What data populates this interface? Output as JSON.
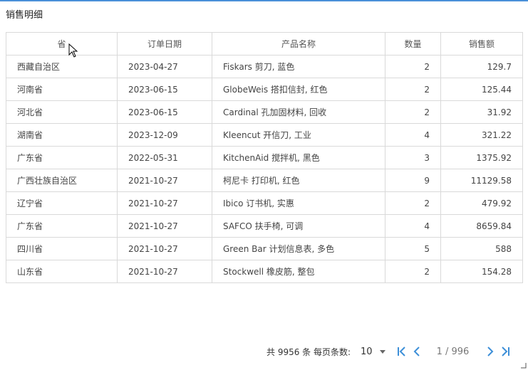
{
  "title": "销售明细",
  "table": {
    "columns": [
      "省",
      "订单日期",
      "产品名称",
      "数量",
      "销售额"
    ],
    "rows": [
      [
        "西藏自治区",
        "2023-04-27",
        "Fiskars 剪刀, 蓝色",
        "2",
        "129.7"
      ],
      [
        "河南省",
        "2023-06-15",
        "GlobeWeis 搭扣信封, 红色",
        "2",
        "125.44"
      ],
      [
        "河北省",
        "2023-06-15",
        "Cardinal 孔加固材料, 回收",
        "2",
        "31.92"
      ],
      [
        "湖南省",
        "2023-12-09",
        "Kleencut 开信刀, 工业",
        "4",
        "321.22"
      ],
      [
        "广东省",
        "2022-05-31",
        "KitchenAid 搅拌机, 黑色",
        "3",
        "1375.92"
      ],
      [
        "广西壮族自治区",
        "2021-10-27",
        "柯尼卡 打印机, 红色",
        "9",
        "11129.58"
      ],
      [
        "辽宁省",
        "2021-10-27",
        "Ibico 订书机, 实惠",
        "2",
        "479.92"
      ],
      [
        "广东省",
        "2021-10-27",
        "SAFCO 扶手椅, 可调",
        "4",
        "8659.84"
      ],
      [
        "四川省",
        "2021-10-27",
        "Green Bar 计划信息表, 多色",
        "5",
        "588"
      ],
      [
        "山东省",
        "2021-10-27",
        "Stockwell 橡皮筋, 整包",
        "2",
        "154.28"
      ]
    ]
  },
  "pager": {
    "total_text": "共 9956 条 每页条数:",
    "page_size": "10",
    "page_info": "1 / 996",
    "accent_color": "#3d8fd8",
    "icons": [
      "first-page-icon",
      "prev-page-icon",
      "next-page-icon",
      "last-page-icon"
    ]
  }
}
